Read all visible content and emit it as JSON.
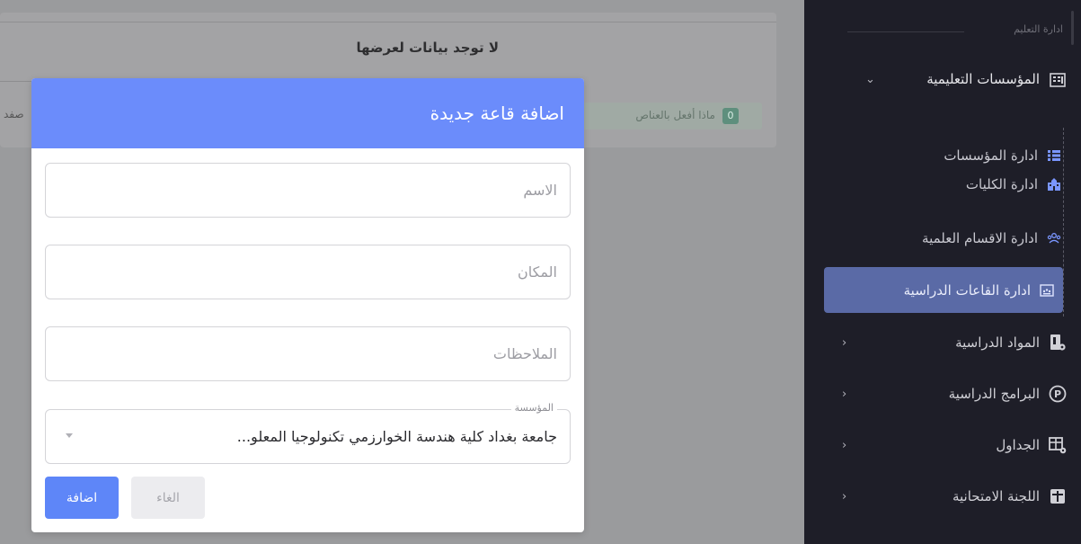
{
  "background": {
    "empty_message": "لا توجد بيانات لعرضها",
    "info_badge": "0",
    "info_text": "ماذا أفعل بالعناص",
    "left_fragment": "صفد"
  },
  "sidebar": {
    "section_label": "ادارة التعليم",
    "main_item": {
      "label": "المؤسسات التعليمية",
      "icon": "building-icon"
    },
    "sub_items": [
      {
        "label": "ادارة المؤسسات",
        "icon": "list-icon",
        "active": false
      },
      {
        "label": "ادارة الكليات",
        "icon": "school-icon",
        "active": false
      },
      {
        "label": "ادارة الاقسام العلمية",
        "icon": "people-icon",
        "active": false
      },
      {
        "label": "ادارة القاعات الدراسية",
        "icon": "classroom-icon",
        "active": true
      }
    ],
    "groups": [
      {
        "label": "المواد الدراسية",
        "icon": "subjects-icon"
      },
      {
        "label": "البرامج الدراسية",
        "icon": "program-p-icon"
      },
      {
        "label": "الجداول",
        "icon": "table-gear-icon"
      },
      {
        "label": "اللجنة الامتحانية",
        "icon": "exam-committee-icon"
      }
    ]
  },
  "modal": {
    "title": "اضافة قاعة جديدة",
    "name_placeholder": "الاسم",
    "location_placeholder": "المكان",
    "notes_placeholder": "الملاحظات",
    "institution_label": "المؤسسة",
    "institution_value": "جامعة بغداد كلية هندسة الخوارزمي تكنولوجيا المعلو...",
    "cancel_label": "الغاء",
    "add_label": "اضافة"
  },
  "colors": {
    "modal_header": "#6b8cfb",
    "primary_button": "#5e86f8",
    "sidebar_bg": "#1e1e28",
    "sidebar_active": "#5a6aa6"
  }
}
